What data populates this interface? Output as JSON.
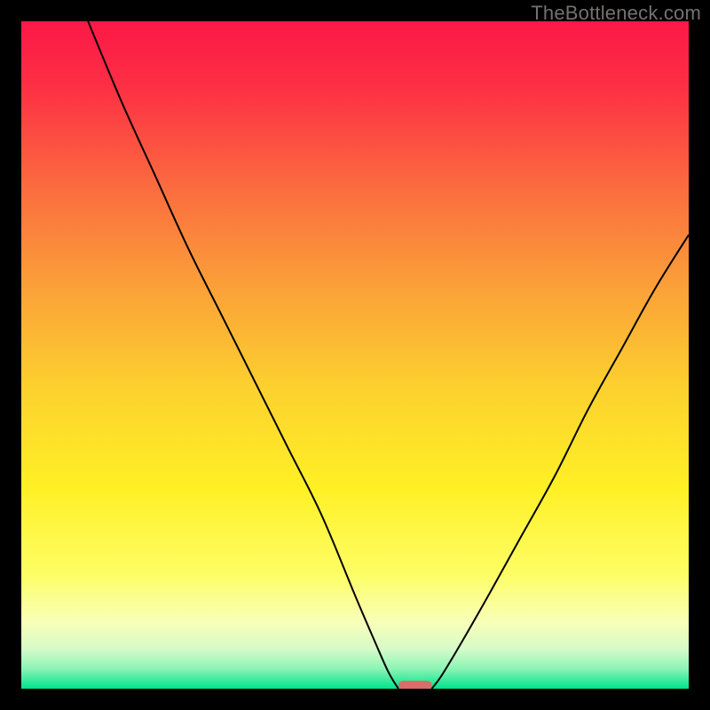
{
  "watermark": "TheBottleneck.com",
  "chart_data": {
    "type": "line",
    "title": "",
    "xlabel": "",
    "ylabel": "",
    "xlim": [
      0,
      100
    ],
    "ylim": [
      0,
      100
    ],
    "grid": false,
    "legend": false,
    "series": [
      {
        "name": "left_branch",
        "x": [
          10,
          15,
          20,
          25,
          30,
          35,
          40,
          45,
          50,
          53,
          55,
          56.5
        ],
        "values": [
          100,
          88,
          77,
          66,
          56,
          46,
          36,
          26,
          14,
          7,
          2.5,
          0
        ]
      },
      {
        "name": "right_branch",
        "x": [
          61.5,
          63,
          66,
          70,
          75,
          80,
          85,
          90,
          95,
          100
        ],
        "values": [
          0,
          2,
          7,
          14,
          23,
          32,
          42,
          51,
          60,
          68
        ]
      }
    ],
    "marker": {
      "name": "bottleneck_marker",
      "x_center": 59,
      "y": 0.5,
      "width_percent": 5,
      "color": "#dc6c6a"
    },
    "background_gradient": {
      "description": "vertical gradient bottleneck heatmap",
      "stops": [
        {
          "pos": 0.0,
          "color": "#fc1847"
        },
        {
          "pos": 0.1,
          "color": "#fd3044"
        },
        {
          "pos": 0.25,
          "color": "#fb6c3f"
        },
        {
          "pos": 0.4,
          "color": "#fba138"
        },
        {
          "pos": 0.55,
          "color": "#fcd12e"
        },
        {
          "pos": 0.7,
          "color": "#fff025"
        },
        {
          "pos": 0.83,
          "color": "#fdfe66"
        },
        {
          "pos": 0.9,
          "color": "#f8ffb8"
        },
        {
          "pos": 0.94,
          "color": "#d7fbc8"
        },
        {
          "pos": 0.97,
          "color": "#8cf4b6"
        },
        {
          "pos": 1.0,
          "color": "#00e48b"
        }
      ]
    }
  }
}
